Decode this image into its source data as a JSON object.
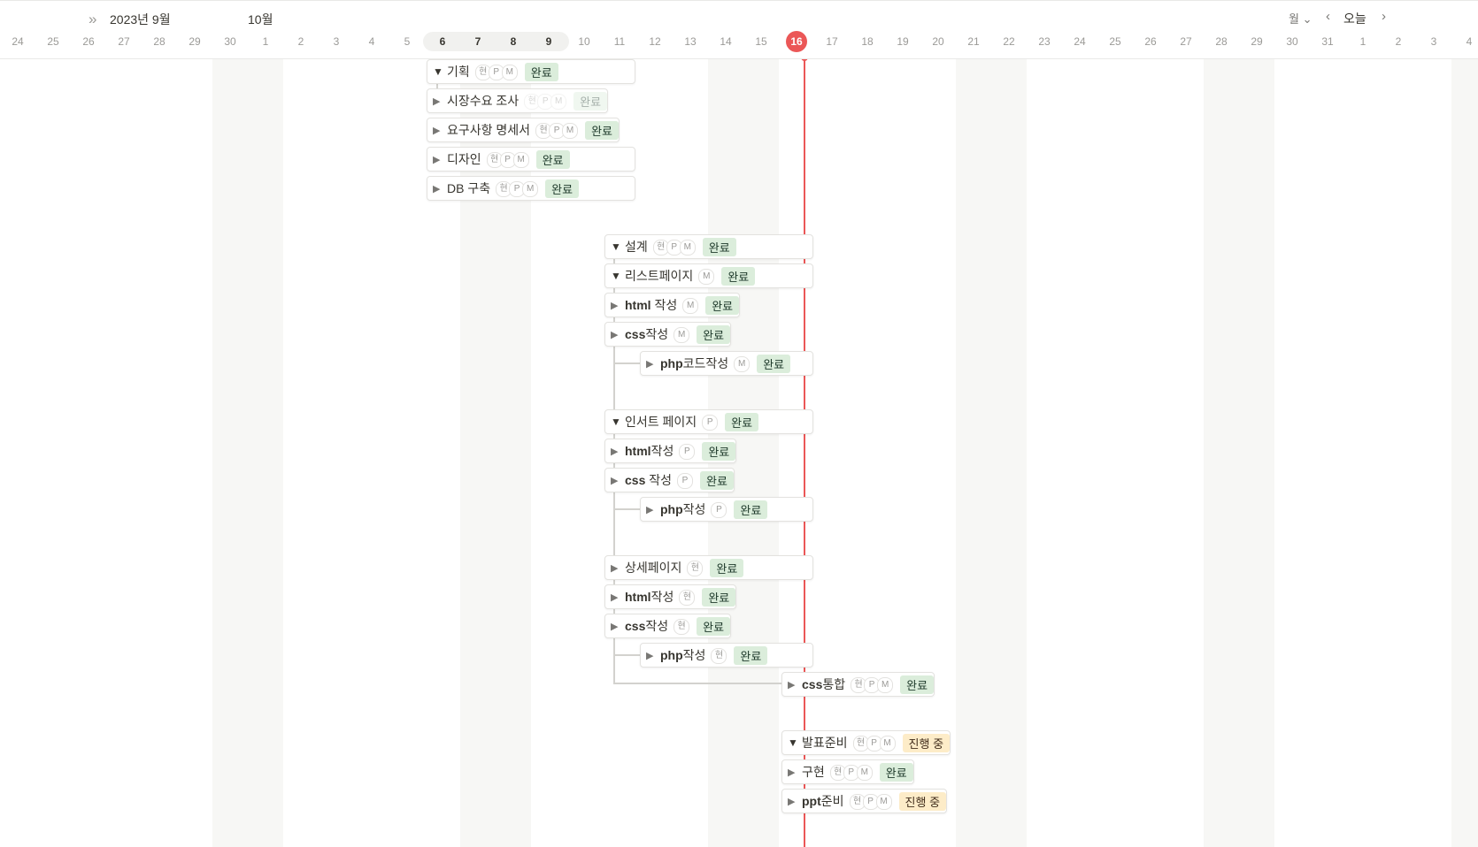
{
  "header": {
    "expand_icon": "double-chevron-right-icon",
    "month_primary": "2023년 9월",
    "month_secondary": "10월",
    "view_select": "월 ⌄",
    "prev_icon": "chevron-left-icon",
    "today_label": "오늘",
    "next_icon": "chevron-right-icon",
    "today_day": "16",
    "days": [
      "24",
      "25",
      "26",
      "27",
      "28",
      "29",
      "30",
      "1",
      "2",
      "3",
      "4",
      "5",
      "6",
      "7",
      "8",
      "9",
      "10",
      "11",
      "12",
      "13",
      "14",
      "15",
      "16",
      "17",
      "18",
      "19",
      "20",
      "21",
      "22",
      "23",
      "24",
      "25",
      "26",
      "27",
      "28",
      "29",
      "30",
      "31",
      "1",
      "2",
      "3",
      "4"
    ]
  },
  "colors": {
    "today_red": "#eb5757",
    "done_bg": "#dbeddb",
    "progress_bg": "#fdecc8"
  },
  "tasks": [
    {
      "title": "기획",
      "toggle": "▼",
      "avatars": [
        "현",
        "P",
        "M"
      ],
      "status": "완료"
    },
    {
      "title": "시장수요 조사",
      "toggle": "▶",
      "avatars": [
        "현",
        "P",
        "M"
      ],
      "status": "완료"
    },
    {
      "title": "요구사항 명세서",
      "toggle": "▶",
      "avatars": [
        "현",
        "P",
        "M"
      ],
      "status": "완료"
    },
    {
      "title": "디자인",
      "toggle": "▶",
      "avatars": [
        "현",
        "P",
        "M"
      ],
      "status": "완료"
    },
    {
      "title": "DB 구축",
      "toggle": "▶",
      "avatars": [
        "현",
        "P",
        "M"
      ],
      "status": "완료"
    },
    {
      "title": "설계",
      "toggle": "▼",
      "avatars": [
        "현",
        "P",
        "M"
      ],
      "status": "완료"
    },
    {
      "title": "리스트페이지",
      "toggle": "▼",
      "avatars": [
        "M"
      ],
      "status": "완료"
    },
    {
      "title_bold": "html",
      "title": " 작성",
      "toggle": "▶",
      "avatars": [
        "M"
      ],
      "status": "완료"
    },
    {
      "title_bold": "css",
      "title": "작성",
      "toggle": "▶",
      "avatars": [
        "M"
      ],
      "status": "완료"
    },
    {
      "title_bold": "php",
      "title": "코드작성",
      "toggle": "▶",
      "avatars": [
        "M"
      ],
      "status": "완료"
    },
    {
      "title": "인서트 페이지",
      "toggle": "▼",
      "avatars": [
        "P"
      ],
      "status": "완료"
    },
    {
      "title_bold": "html",
      "title": "작성",
      "toggle": "▶",
      "avatars": [
        "P"
      ],
      "status": "완료"
    },
    {
      "title_bold": "css",
      "title": " 작성",
      "toggle": "▶",
      "avatars": [
        "P"
      ],
      "status": "완료"
    },
    {
      "title_bold": "php",
      "title": "작성",
      "toggle": "▶",
      "avatars": [
        "P"
      ],
      "status": "완료"
    },
    {
      "title": "상세페이지",
      "toggle": "▶",
      "avatars": [
        "현"
      ],
      "status": "완료"
    },
    {
      "title_bold": "html",
      "title": "작성",
      "toggle": "▶",
      "avatars": [
        "현"
      ],
      "status": "완료"
    },
    {
      "title_bold": "css",
      "title": "작성",
      "toggle": "▶",
      "avatars": [
        "현"
      ],
      "status": "완료"
    },
    {
      "title_bold": "php",
      "title": "작성",
      "toggle": "▶",
      "avatars": [
        "현"
      ],
      "status": "완료"
    },
    {
      "title_bold": "css",
      "title": "통합",
      "toggle": "▶",
      "avatars": [
        "현",
        "P",
        "M"
      ],
      "status": "완료"
    },
    {
      "title": "발표준비",
      "toggle": "▼",
      "avatars": [
        "현",
        "P",
        "M"
      ],
      "status": "진행 중"
    },
    {
      "title": "구현",
      "toggle": "▶",
      "avatars": [
        "현",
        "P",
        "M"
      ],
      "status": "완료"
    },
    {
      "title_bold": "ppt",
      "title": "준비",
      "toggle": "▶",
      "avatars": [
        "현",
        "P",
        "M"
      ],
      "status": "진행 중"
    }
  ]
}
